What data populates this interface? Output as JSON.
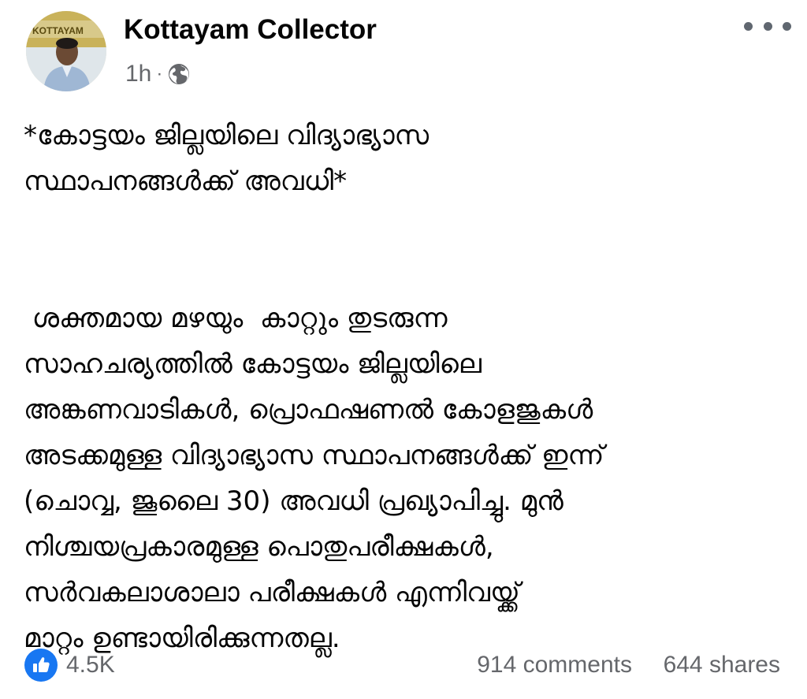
{
  "post": {
    "author": {
      "name": "Kottayam Collector",
      "avatar_badge_text": "KOTTAYAM"
    },
    "meta": {
      "time": "1h",
      "separator": "·",
      "audience_icon": "globe-icon"
    },
    "more_icon": "more-options-icon",
    "title_lines": [
      "*കോട്ടയം ജില്ലയിലെ വിദ്യാഭ്യാസ",
      "സ്ഥാപനങ്ങൾക്ക് അവധി*"
    ],
    "body_lines": [
      " ശക്തമായ മഴയും  കാറ്റും തുടരുന്ന",
      "സാഹചര്യത്തിൽ കോട്ടയം ജില്ലയിലെ",
      "അങ്കണവാടികൾ, പ്രൊഫഷണൽ കോളജുകൾ",
      "അടക്കമുള്ള വിദ്യാഭ്യാസ സ്ഥാപനങ്ങൾക്ക് ഇന്ന്",
      "(ചൊവ്വ, ജൂലൈ 30) അവധി പ്രഖ്യാപിച്ചു. മുൻ",
      "നിശ്ചയപ്രകാരമുള്ള പൊതുപരീക്ഷകൾ,",
      "സർവകലാശാലാ പരീക്ഷകൾ എന്നിവയ്ക്ക്",
      "മാറ്റം ഉണ്ടായിരിക്കുന്നതല്ല."
    ],
    "footer": {
      "reaction_icon": "like-icon",
      "reactions": "4.5K",
      "comments": "914 comments",
      "shares": "644 shares"
    }
  },
  "colors": {
    "text_primary": "#050505",
    "text_secondary": "#65676b",
    "like_blue": "#1877f2",
    "more_dots": "#606770"
  }
}
